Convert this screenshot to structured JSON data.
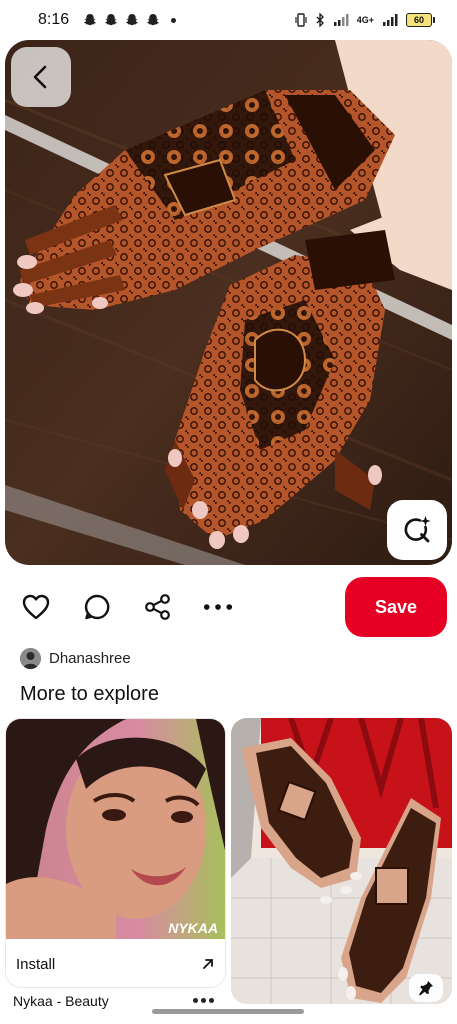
{
  "status_bar": {
    "time": "8:16",
    "battery": "60",
    "network_label": "4G+",
    "notification_icons": [
      "snapchat-icon",
      "snapchat-icon",
      "snapchat-icon",
      "snapchat-icon"
    ]
  },
  "pin": {
    "back_icon": "chevron-left-icon",
    "visual_search_icon": "lens-sparkle-icon"
  },
  "actions": {
    "icons": [
      "heart-icon",
      "comment-icon",
      "share-icon",
      "more-icon"
    ],
    "save_label": "Save",
    "save_color": "#e60023"
  },
  "creator": {
    "name": "Dhanashree"
  },
  "explore": {
    "title": "More to explore",
    "cards": [
      {
        "watermark": "NYKAA",
        "cta_label": "Install",
        "cta_icon": "arrow-up-right-icon",
        "title": "Nykaa - Beauty"
      },
      {
        "action_icon": "pin-icon"
      }
    ]
  }
}
